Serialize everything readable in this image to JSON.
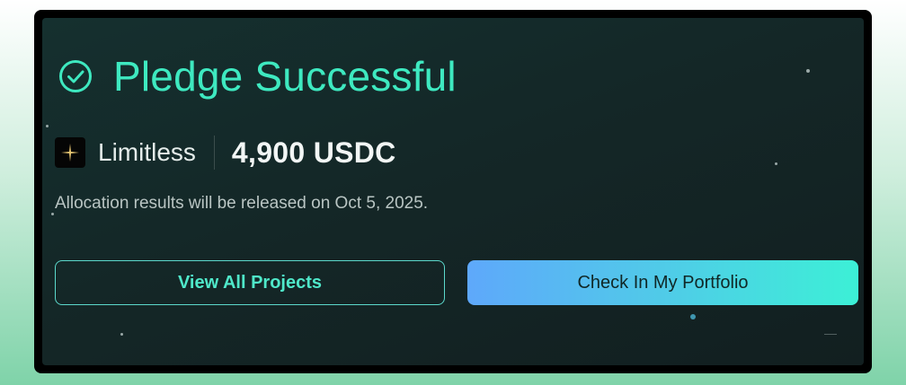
{
  "title": "Pledge Successful",
  "project": {
    "name": "Limitless",
    "logo_icon": "sparkle-icon"
  },
  "amount": "4,900 USDC",
  "note": "Allocation results will be released on Oct 5, 2025.",
  "buttons": {
    "view_all": "View All Projects",
    "portfolio": "Check In My Portfolio"
  },
  "colors": {
    "accent": "#3ee9c0",
    "card_background": "#142727",
    "primary_gradient_start": "#5ea8fb",
    "primary_gradient_end": "#3cf0d6"
  }
}
